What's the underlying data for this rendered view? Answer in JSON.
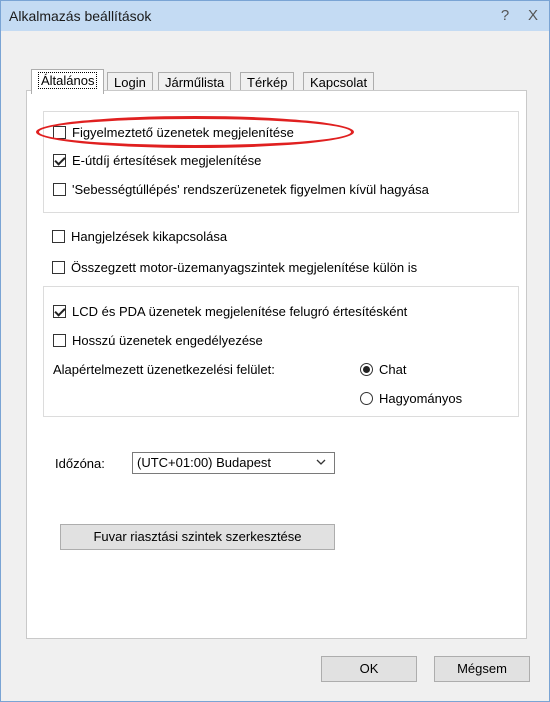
{
  "window": {
    "title": "Alkalmazás beállítások",
    "help_label": "?",
    "close_label": "X"
  },
  "tabs": [
    {
      "label": "Általános",
      "active": true
    },
    {
      "label": "Login",
      "active": false
    },
    {
      "label": "Járműlista",
      "active": false
    },
    {
      "label": "Térkép",
      "active": false
    },
    {
      "label": "Kapcsolat",
      "active": false
    }
  ],
  "group1": {
    "items": [
      {
        "label": "Figyelmeztető üzenetek megjelenítése",
        "checked": false
      },
      {
        "label": "E-útdíj értesítések megjelenítése",
        "checked": true
      },
      {
        "label": "'Sebességtúllépés' rendszerüzenetek figyelmen kívül hagyása",
        "checked": false
      }
    ]
  },
  "standalone": {
    "items": [
      {
        "label": "Hangjelzések kikapcsolása",
        "checked": false
      },
      {
        "label": "Összegzett motor-üzemanyagszintek megjelenítése külön is",
        "checked": false
      }
    ]
  },
  "group2": {
    "items": [
      {
        "label": "LCD és PDA üzenetek megjelenítése felugró értesítésként",
        "checked": true
      },
      {
        "label": "Hosszú üzenetek engedélyezése",
        "checked": false
      }
    ],
    "interface_label": "Alapértelmezett üzenetkezelési felület:",
    "radio_options": [
      {
        "label": "Chat",
        "checked": true
      },
      {
        "label": "Hagyományos",
        "checked": false
      }
    ]
  },
  "timezone": {
    "label": "Időzóna:",
    "value": "(UTC+01:00) Budapest"
  },
  "cargo_button_label": "Fuvar riasztási szintek szerkesztése",
  "footer": {
    "ok_label": "OK",
    "cancel_label": "Mégsem"
  },
  "colors": {
    "titlebar": "#c4dbf3",
    "highlight": "#e02020",
    "dialog_bg": "#f0f0f0"
  }
}
